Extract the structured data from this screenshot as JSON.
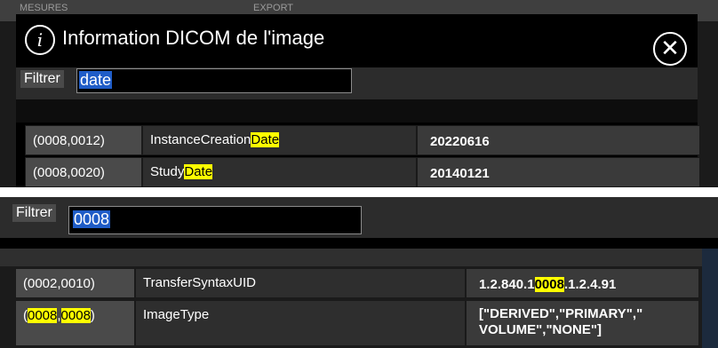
{
  "top": {
    "background_tabs": [
      "MESURES",
      "EXPORT"
    ],
    "dialog": {
      "title": "Information DICOM de l'image",
      "icons": [
        "info-icon",
        "close-icon"
      ]
    },
    "filter": {
      "label": "Filtrer",
      "value": "date"
    },
    "rows": [
      {
        "tag": "(0008,0012)",
        "name_prefix": "InstanceCreation",
        "name_highlight": "Date",
        "value": "20220616"
      },
      {
        "tag": "(0008,0020)",
        "name_prefix": "Study",
        "name_highlight": "Date",
        "value": "20140121"
      }
    ]
  },
  "bottom": {
    "filter": {
      "label": "Filtrer",
      "value": "0008"
    },
    "rows": [
      {
        "tag": "(0002,0010)",
        "name": "TransferSyntaxUID",
        "value_prefix": "1.2.840.1",
        "value_highlight": "0008",
        "value_suffix": ".1.2.4.91"
      },
      {
        "tag_open": "(",
        "tag_hl1": "0008",
        "tag_sep": ",",
        "tag_hl2": "0008",
        "tag_close": ")",
        "name": "ImageType",
        "value_line1": "[\"DERIVED\",\"PRIMARY\",\"",
        "value_line2": "VOLUME\",\"NONE\"]"
      }
    ]
  },
  "colors": {
    "highlight": "#ffff00",
    "selection": "#1f5cc7",
    "dialog_bg": "#000000",
    "cell_tag": "#4a4a4a",
    "cell_name": "#2e2e2e",
    "cell_value": "#3a3a3a"
  }
}
